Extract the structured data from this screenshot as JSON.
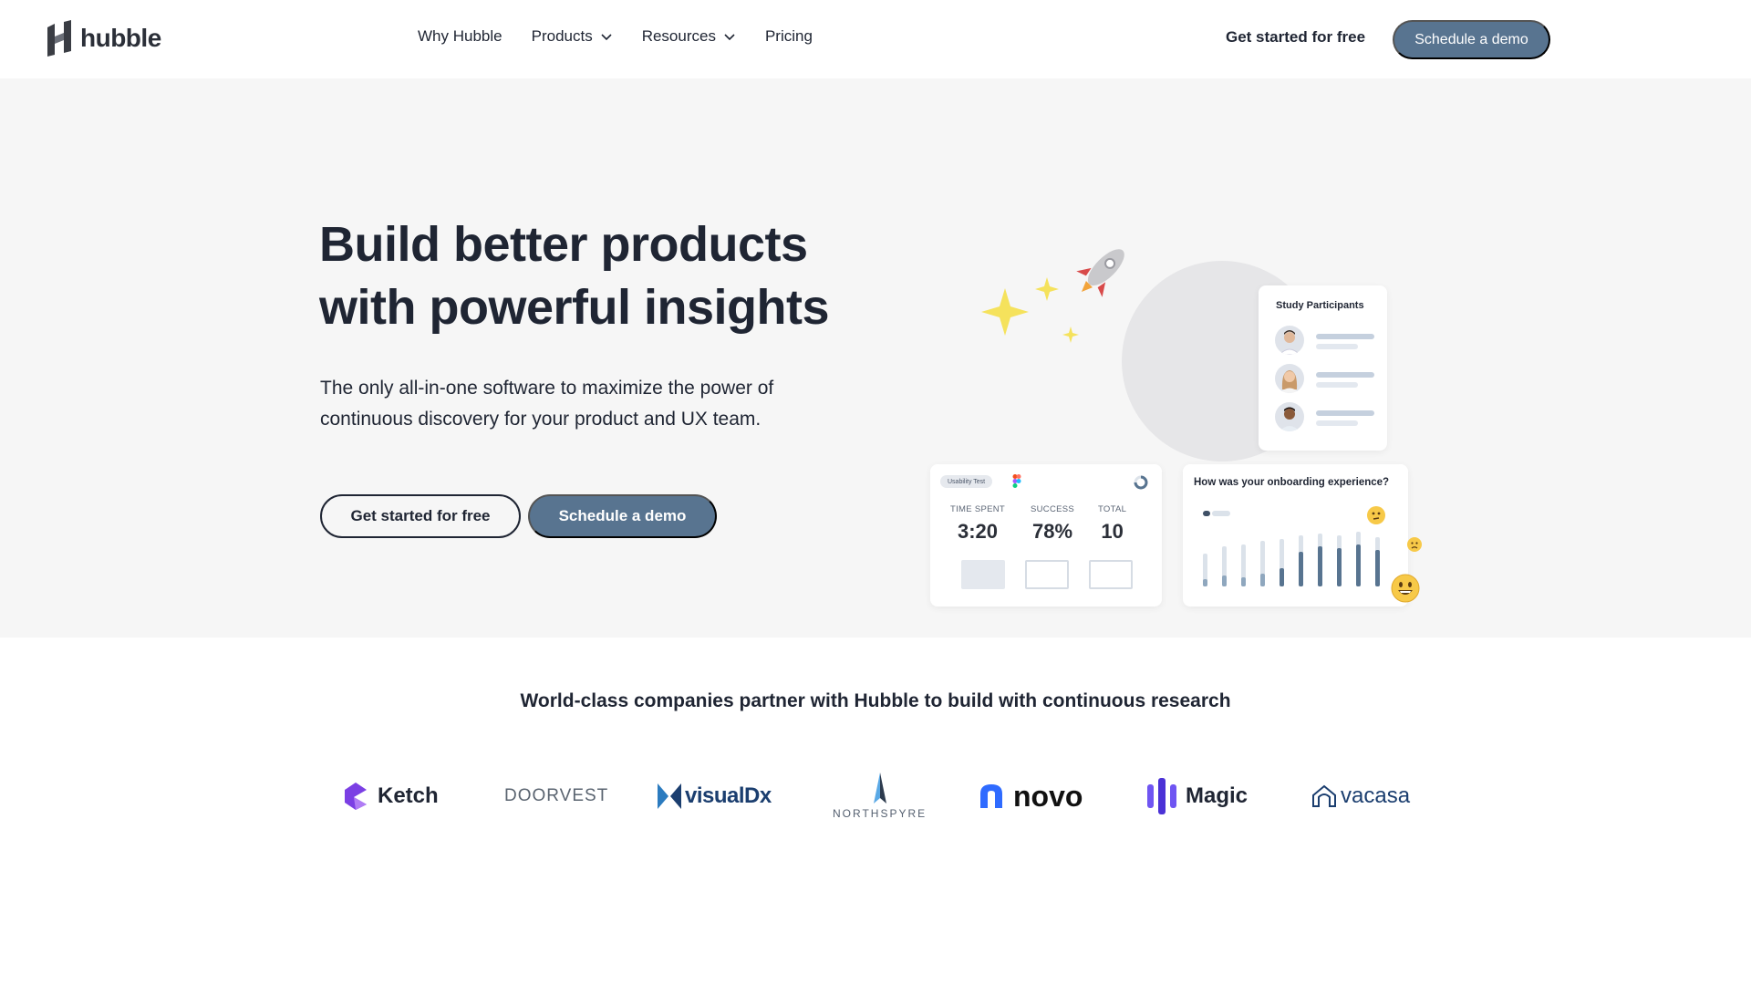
{
  "brand": {
    "name": "hubble",
    "logo_icon": "hubble-logo-icon"
  },
  "nav": {
    "links": [
      {
        "label": "Why Hubble",
        "has_dropdown": false
      },
      {
        "label": "Products",
        "has_dropdown": true
      },
      {
        "label": "Resources",
        "has_dropdown": true
      },
      {
        "label": "Pricing",
        "has_dropdown": false
      }
    ],
    "cta_text": "Get started for free",
    "cta_button": "Schedule a demo"
  },
  "hero": {
    "title_line1": "Build better products",
    "title_line2": "with powerful insights",
    "subtitle": "The only all-in-one software to maximize the power of continuous discovery for your product and UX team.",
    "btn_primary": "Get started for free",
    "btn_secondary": "Schedule a demo"
  },
  "illustration": {
    "participants_title": "Study Participants",
    "usability_tag": "Usability Test",
    "stats": [
      {
        "label": "TIME SPENT",
        "value": "3:20"
      },
      {
        "label": "SUCCESS",
        "value": "78%"
      },
      {
        "label": "TOTAL",
        "value": "10"
      }
    ],
    "onboarding_title": "How was your onboarding experience?"
  },
  "partners": {
    "title": "World-class companies partner with Hubble to build with continuous research",
    "logos": [
      {
        "name": "Ketch",
        "color": "#7b3fe4"
      },
      {
        "name": "DOORVEST",
        "color": "#5a6470"
      },
      {
        "name": "visualDx",
        "color": "#1b3e6f"
      },
      {
        "name": "NORTHSPYRE",
        "color": "#556070"
      },
      {
        "name": "novo",
        "color": "#111111"
      },
      {
        "name": "Magic",
        "color": "#5a3ce0"
      },
      {
        "name": "vacasa",
        "color": "#1b3e6f"
      }
    ]
  },
  "colors": {
    "accent": "#587490",
    "text": "#1f2533",
    "hero_bg": "#f6f6f6"
  }
}
